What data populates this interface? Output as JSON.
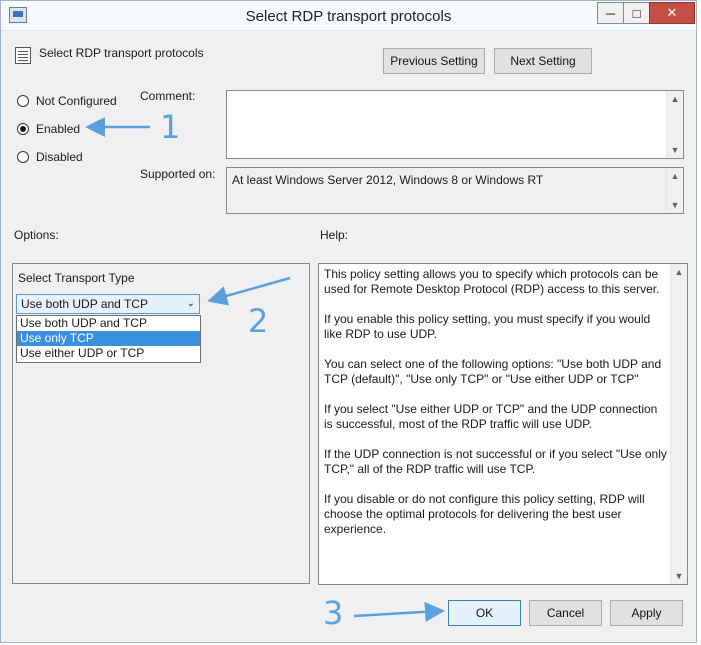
{
  "window": {
    "title": "Select RDP transport protocols",
    "controls": {
      "minimize": "─",
      "maximize": "□",
      "close": "✕"
    }
  },
  "header": {
    "setting_name": "Select RDP transport protocols",
    "previous_label": "Previous Setting",
    "next_label": "Next Setting"
  },
  "state": {
    "options": [
      {
        "label": "Not Configured",
        "selected": false
      },
      {
        "label": "Enabled",
        "selected": true
      },
      {
        "label": "Disabled",
        "selected": false
      }
    ]
  },
  "comment": {
    "label": "Comment:",
    "value": ""
  },
  "supported": {
    "label": "Supported on:",
    "value": "At least Windows Server 2012, Windows 8 or Windows RT"
  },
  "options_section": {
    "label": "Options:",
    "transport_label": "Select Transport Type",
    "selected_value": "Use both UDP and TCP",
    "dropdown_options": [
      "Use both UDP and TCP",
      "Use only TCP",
      "Use either UDP or TCP"
    ],
    "highlighted_index": 1
  },
  "help": {
    "label": "Help:",
    "paragraphs": [
      "This policy setting allows you to specify which protocols can be used for Remote Desktop Protocol (RDP) access to this server.",
      "If you enable this policy setting, you must specify if you would like RDP to use UDP.",
      "You can select one of the following options: \"Use both UDP and TCP (default)\", \"Use only TCP\" or \"Use either UDP or TCP\"",
      "If you select \"Use either UDP or TCP\" and the UDP connection is successful, most of the RDP traffic will use UDP.",
      "If the UDP connection is not successful or if you select \"Use only TCP,\" all of the RDP traffic will use TCP.",
      "If you disable or do not configure this policy setting, RDP will choose the optimal protocols for delivering the best user experience."
    ]
  },
  "footer": {
    "ok_label": "OK",
    "cancel_label": "Cancel",
    "apply_label": "Apply"
  },
  "annotations": {
    "step1": "1",
    "step2": "2",
    "step3": "3",
    "color": "#5a9fe0"
  },
  "icons": {
    "scroll_up": "▲",
    "scroll_down": "▼",
    "dropdown": "⌄"
  }
}
